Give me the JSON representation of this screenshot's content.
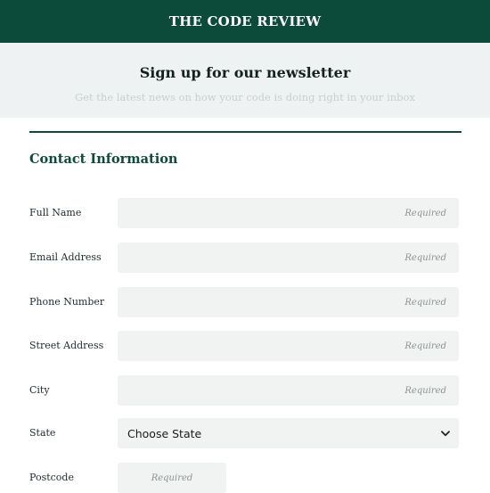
{
  "header": {
    "brand": "THE CODE REVIEW"
  },
  "hero": {
    "title": "Sign up for our newsletter",
    "subtitle": "Get the latest news on how your code is doing right in your inbox"
  },
  "form": {
    "section_title": "Contact Information",
    "fields": [
      {
        "label": "Full Name",
        "placeholder": "Required"
      },
      {
        "label": "Email Address",
        "placeholder": "Required"
      },
      {
        "label": "Phone Number",
        "placeholder": "Required"
      },
      {
        "label": "Street Address",
        "placeholder": "Required"
      },
      {
        "label": "City",
        "placeholder": "Required"
      }
    ],
    "state": {
      "label": "State",
      "selected": "Choose State",
      "icon": "chevron-down-icon"
    },
    "postcode": {
      "label": "Postcode",
      "placeholder": "Required"
    }
  },
  "colors": {
    "brand_green": "#0c4a39",
    "hero_bg": "#eef2f2",
    "field_bg": "#f1f3f2"
  }
}
